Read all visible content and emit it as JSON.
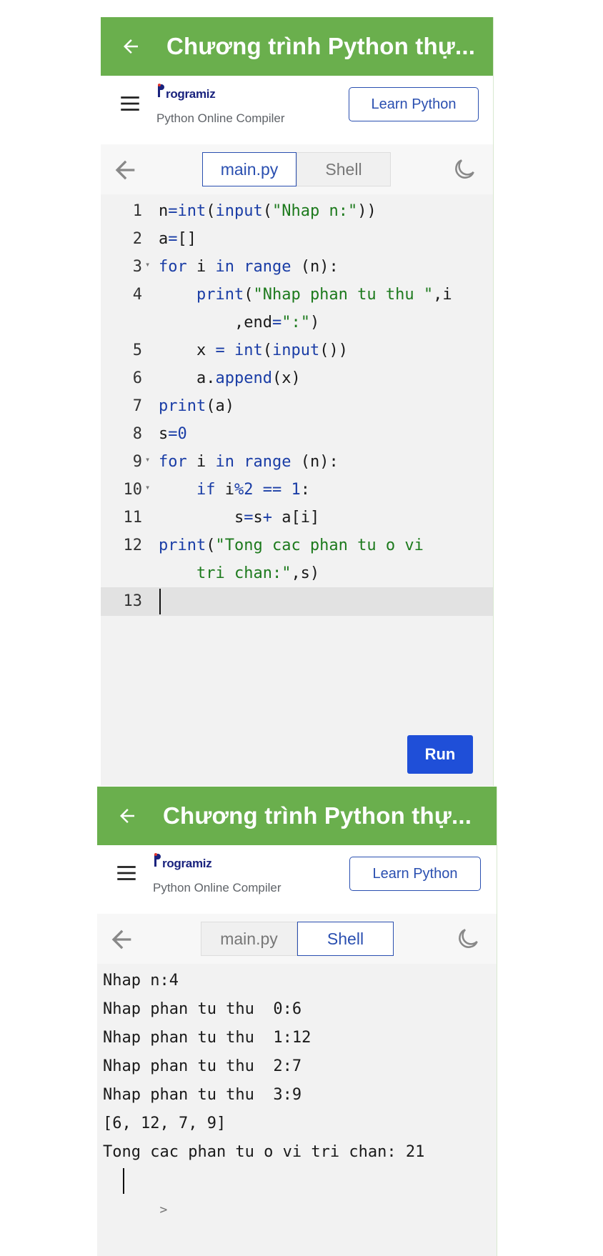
{
  "top": {
    "appbar": {
      "title": "Chương trình Python thự..."
    },
    "header": {
      "logo_text": "rogramiz",
      "subtitle": "Python Online Compiler",
      "learn_button": "Learn Python"
    },
    "tabs": [
      {
        "label": "main.py",
        "active": true
      },
      {
        "label": "Shell",
        "active": false
      }
    ],
    "editor": {
      "line_numbers": [
        "1",
        "2",
        "3",
        "4",
        "5",
        "6",
        "7",
        "8",
        "9",
        "10",
        "11",
        "12",
        "13"
      ],
      "lines": [
        "n=int(input(\"Nhap n:\"))",
        "a=[]",
        "for i in range (n):",
        "    print(\"Nhap phan tu thu \",i",
        "        ,end=\":\")",
        "    x = int(input())",
        "    a.append(x)",
        "print(a)",
        "s=0",
        "for i in range (n):",
        "    if i%2 == 1:",
        "        s=s+ a[i]",
        "print(\"Tong cac phan tu o vi",
        "    tri chan:\",s)"
      ],
      "active_line": "13"
    },
    "run_button": "Run"
  },
  "bottom": {
    "appbar": {
      "title": "Chương trình Python thự..."
    },
    "header": {
      "logo_text": "rogramiz",
      "subtitle": "Python Online Compiler",
      "learn_button": "Learn Python"
    },
    "tabs": [
      {
        "label": "main.py",
        "active": false
      },
      {
        "label": "Shell",
        "active": true
      }
    ],
    "shell_output": [
      "Nhap n:4",
      "Nhap phan tu thu  0:6",
      "Nhap phan tu thu  1:12",
      "Nhap phan tu thu  2:7",
      "Nhap phan tu thu  3:9",
      "[6, 12, 7, 9]",
      "Tong cac phan tu o vi tri chan: 21"
    ],
    "prompt": ">"
  },
  "colors": {
    "appbar": "#6aaf4d",
    "accent": "#2a4fb0",
    "run_button": "#1f4fd8",
    "string": "#1d7a1d",
    "keyword": "#1a3da6"
  },
  "icons": [
    "back-arrow-icon",
    "hamburger-menu-icon",
    "programiz-logo-icon",
    "moon-icon"
  ]
}
